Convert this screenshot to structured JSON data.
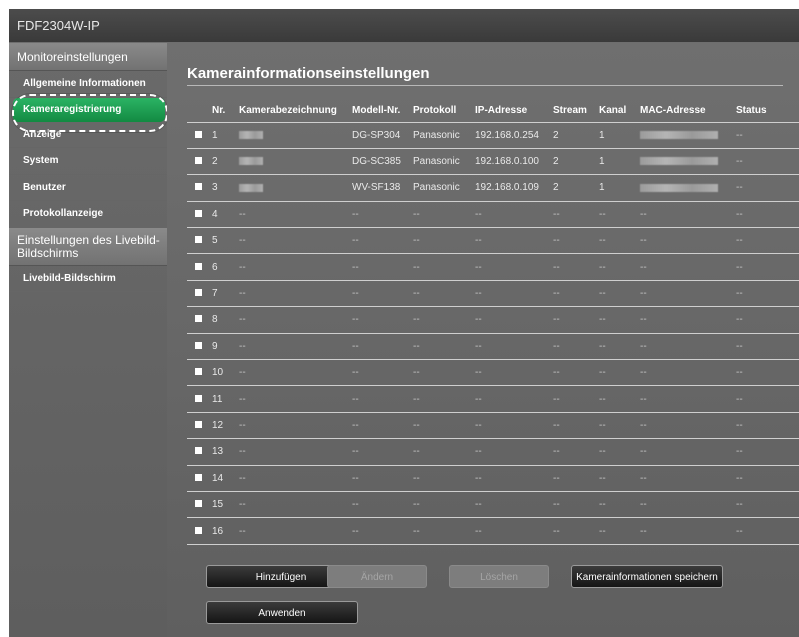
{
  "app": {
    "title": "FDF2304W-IP"
  },
  "sidebar": {
    "sections": [
      {
        "title": "Monitoreinstellungen"
      },
      {
        "title": "Einstellungen des Livebild-Bildschirms"
      }
    ],
    "items_monitor": [
      {
        "label": "Allgemeine Informationen"
      },
      {
        "label": "Kameraregistrierung",
        "active": true
      },
      {
        "label": "Anzeige"
      },
      {
        "label": "System"
      },
      {
        "label": "Benutzer"
      },
      {
        "label": "Protokollanzeige"
      }
    ],
    "items_live": [
      {
        "label": "Livebild-Bildschirm"
      }
    ],
    "active_color": "#1fa257"
  },
  "main": {
    "title": "Kamerainformationseinstellungen",
    "columns": [
      "Nr.",
      "Kamerabezeichnung",
      "Modell-Nr.",
      "Protokoll",
      "IP-Adresse",
      "Stream",
      "Kanal",
      "MAC-Adresse",
      "Status"
    ],
    "rows": [
      {
        "nr": "1",
        "name": "",
        "model": "DG-SP304",
        "protocol": "Panasonic",
        "ip": "192.168.0.254",
        "stream": "2",
        "channel": "1",
        "mac": "",
        "status": "--"
      },
      {
        "nr": "2",
        "name": "",
        "model": "DG-SC385",
        "protocol": "Panasonic",
        "ip": "192.168.0.100",
        "stream": "2",
        "channel": "1",
        "mac": "",
        "status": "--"
      },
      {
        "nr": "3",
        "name": "",
        "model": "WV-SF138",
        "protocol": "Panasonic",
        "ip": "192.168.0.109",
        "stream": "2",
        "channel": "1",
        "mac": "",
        "status": "--"
      },
      {
        "nr": "4",
        "name": "--",
        "model": "--",
        "protocol": "--",
        "ip": "--",
        "stream": "--",
        "channel": "--",
        "mac": "--",
        "status": "--"
      },
      {
        "nr": "5",
        "name": "--",
        "model": "--",
        "protocol": "--",
        "ip": "--",
        "stream": "--",
        "channel": "--",
        "mac": "--",
        "status": "--"
      },
      {
        "nr": "6",
        "name": "--",
        "model": "--",
        "protocol": "--",
        "ip": "--",
        "stream": "--",
        "channel": "--",
        "mac": "--",
        "status": "--"
      },
      {
        "nr": "7",
        "name": "--",
        "model": "--",
        "protocol": "--",
        "ip": "--",
        "stream": "--",
        "channel": "--",
        "mac": "--",
        "status": "--"
      },
      {
        "nr": "8",
        "name": "--",
        "model": "--",
        "protocol": "--",
        "ip": "--",
        "stream": "--",
        "channel": "--",
        "mac": "--",
        "status": "--"
      },
      {
        "nr": "9",
        "name": "--",
        "model": "--",
        "protocol": "--",
        "ip": "--",
        "stream": "--",
        "channel": "--",
        "mac": "--",
        "status": "--"
      },
      {
        "nr": "10",
        "name": "--",
        "model": "--",
        "protocol": "--",
        "ip": "--",
        "stream": "--",
        "channel": "--",
        "mac": "--",
        "status": "--"
      },
      {
        "nr": "11",
        "name": "--",
        "model": "--",
        "protocol": "--",
        "ip": "--",
        "stream": "--",
        "channel": "--",
        "mac": "--",
        "status": "--"
      },
      {
        "nr": "12",
        "name": "--",
        "model": "--",
        "protocol": "--",
        "ip": "--",
        "stream": "--",
        "channel": "--",
        "mac": "--",
        "status": "--"
      },
      {
        "nr": "13",
        "name": "--",
        "model": "--",
        "protocol": "--",
        "ip": "--",
        "stream": "--",
        "channel": "--",
        "mac": "--",
        "status": "--"
      },
      {
        "nr": "14",
        "name": "--",
        "model": "--",
        "protocol": "--",
        "ip": "--",
        "stream": "--",
        "channel": "--",
        "mac": "--",
        "status": "--"
      },
      {
        "nr": "15",
        "name": "--",
        "model": "--",
        "protocol": "--",
        "ip": "--",
        "stream": "--",
        "channel": "--",
        "mac": "--",
        "status": "--"
      },
      {
        "nr": "16",
        "name": "--",
        "model": "--",
        "protocol": "--",
        "ip": "--",
        "stream": "--",
        "channel": "--",
        "mac": "--",
        "status": "--"
      }
    ],
    "buttons": {
      "add": "Hinzufügen",
      "change": "Ändern",
      "delete": "Löschen",
      "save": "Kamerainformationen speichern",
      "apply": "Anwenden"
    }
  }
}
